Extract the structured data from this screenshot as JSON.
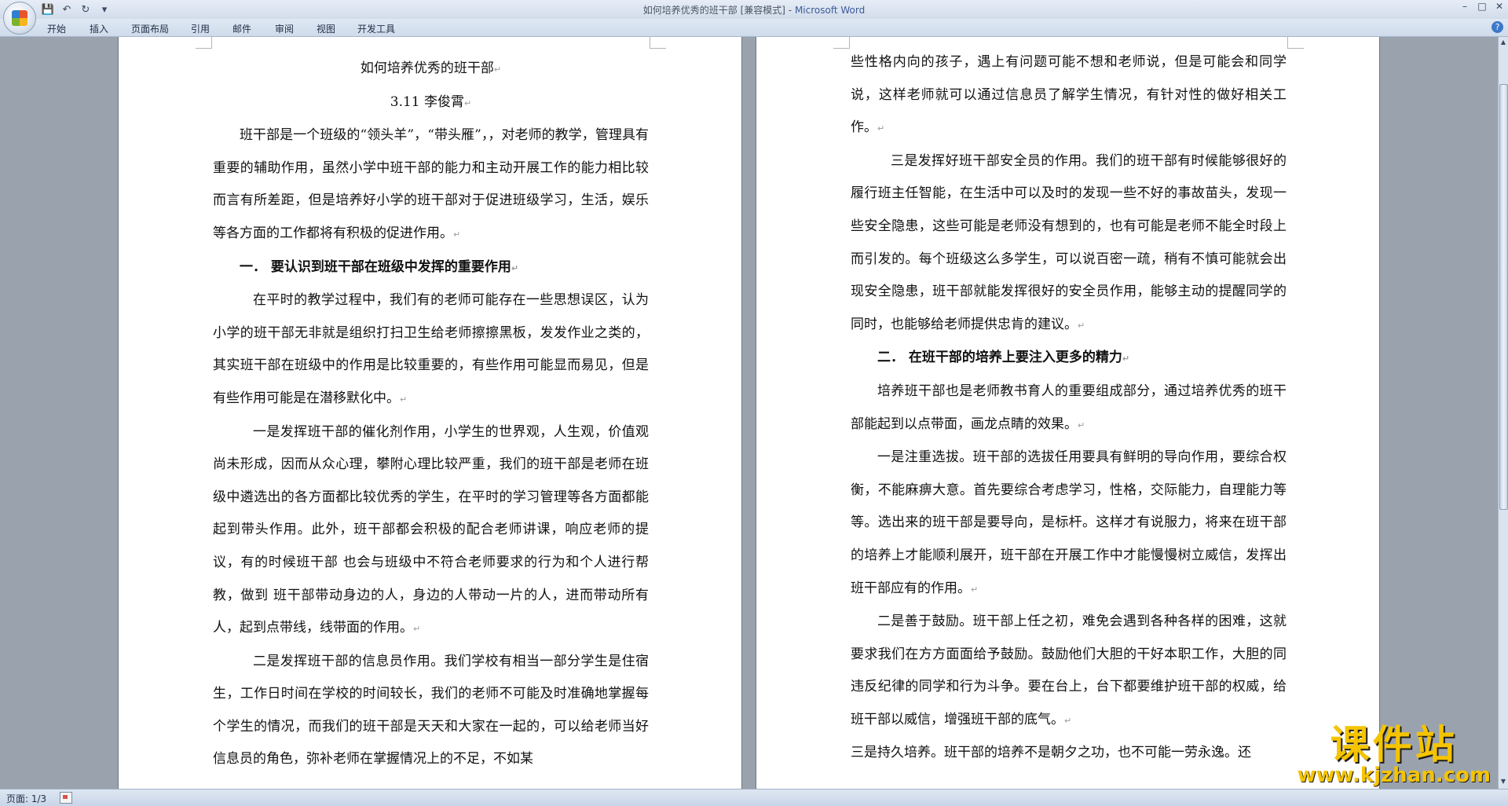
{
  "window": {
    "title": "如何培养优秀的班干部 [兼容模式]",
    "title_sep": " - ",
    "app_name": "Microsoft Word",
    "controls": [
      "–",
      "□",
      "✕"
    ]
  },
  "quick_access": [
    "save-icon",
    "undo-icon",
    "redo-icon",
    "customize-icon"
  ],
  "ribbon": {
    "tabs": [
      "开始",
      "插入",
      "页面布局",
      "引用",
      "邮件",
      "审阅",
      "视图",
      "开发工具"
    ]
  },
  "document": {
    "left_page": {
      "title": "如何培养优秀的班干部",
      "author": "3.11 李俊霄",
      "p1": "班干部是一个班级的“领头羊”，“带头雁”，，对老师的教学，管理具有重要的辅助作用，虽然小学中班干部的能力和主动开展工作的能力相比较而言有所差距，但是培养好小学的班干部对于促进班级学习，生活，娱乐等各方面的工作都将有积极的促进作用。",
      "h1": "一．  要认识到班干部在班级中发挥的重要作用",
      "p2": "在平时的教学过程中，我们有的老师可能存在一些思想误区，认为小学的班干部无非就是组织打扫卫生给老师擦擦黑板，发发作业之类的，其实班干部在班级中的作用是比较重要的，有些作用可能显而易见，但是有些作用可能是在潜移默化中。",
      "p3": "一是发挥班干部的催化剂作用，小学生的世界观，人生观，价值观尚未形成，因而从众心理，攀附心理比较严重，我们的班干部是老师在班级中遴选出的各方面都比较优秀的学生，在平时的学习管理等各方面都能起到带头作用。此外，班干部都会积极的配合老师讲课，响应老师的提议，有的时候班干部  也会与班级中不符合老师要求的行为和个人进行帮教，做到  班干部带动身边的人，身边的人带动一片的人，进而带动所有人，起到点带线，线带面的作用。",
      "p4": "二是发挥班干部的信息员作用。我们学校有相当一部分学生是住宿生，工作日时间在学校的时间较长，我们的老师不可能及时准确地掌握每个学生的情况，而我们的班干部是天天和大家在一起的，可以给老师当好信息员的角色，弥补老师在掌握情况上的不足，不如某"
    },
    "right_page": {
      "p1": "些性格内向的孩子，遇上有问题可能不想和老师说，但是可能会和同学说，这样老师就可以通过信息员了解学生情况，有针对性的做好相关工作。",
      "p2": "三是发挥好班干部安全员的作用。我们的班干部有时候能够很好的履行班主任智能，在生活中可以及时的发现一些不好的事故苗头，发现一些安全隐患，这些可能是老师没有想到的，也有可能是老师不能全时段上而引发的。每个班级这么多学生，可以说百密一疏，稍有不慎可能就会出现安全隐患，班干部就能发挥很好的安全员作用，能够主动的提醒同学的同时，也能够给老师提供忠肯的建议。",
      "h2": "二．  在班干部的培养上要注入更多的精力",
      "p3": "培养班干部也是老师教书育人的重要组成部分，通过培养优秀的班干部能起到以点带面，画龙点睛的效果。",
      "p4": "一是注重选拔。班干部的选拔任用要具有鲜明的导向作用，要综合权衡，不能麻痹大意。首先要综合考虑学习，性格，交际能力，自理能力等等。选出来的班干部是要导向，是标杆。这样才有说服力，将来在班干部的培养上才能顺利展开，班干部在开展工作中才能慢慢树立威信，发挥出班干部应有的作用。",
      "p5": "二是善于鼓励。班干部上任之初，难免会遇到各种各样的困难，这就要求我们在方方面面给予鼓励。鼓励他们大胆的干好本职工作，大胆的同违反纪律的同学和行为斗争。要在台上，台下都要维护班干部的权威，给班干部以威信，增强班干部的底气。",
      "p6": "三是持久培养。班干部的培养不是朝夕之功，也不可能一劳永逸。还"
    }
  },
  "status_bar": {
    "page_info": "页面: 1/3"
  },
  "watermark": {
    "title": "课件站",
    "url": "www.kjzhan.com"
  },
  "colors": {
    "title_text": "#4b5563",
    "app_name": "#3b5b9a",
    "canvas_bg": "#9aa3ad",
    "watermark": "#f5c400"
  }
}
